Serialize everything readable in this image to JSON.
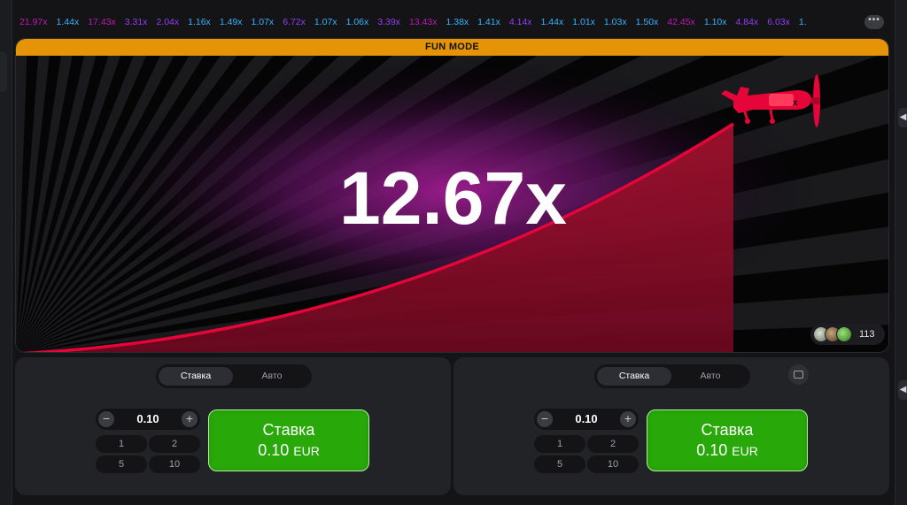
{
  "history": [
    {
      "text": "21.97x",
      "color": "pink"
    },
    {
      "text": "1.44x",
      "color": "blue"
    },
    {
      "text": "17.43x",
      "color": "pink"
    },
    {
      "text": "3.31x",
      "color": "purple"
    },
    {
      "text": "2.04x",
      "color": "purple"
    },
    {
      "text": "1.16x",
      "color": "blue"
    },
    {
      "text": "1.49x",
      "color": "blue"
    },
    {
      "text": "1.07x",
      "color": "blue"
    },
    {
      "text": "6.72x",
      "color": "purple"
    },
    {
      "text": "1.07x",
      "color": "blue"
    },
    {
      "text": "1.06x",
      "color": "blue"
    },
    {
      "text": "3.39x",
      "color": "purple"
    },
    {
      "text": "13.43x",
      "color": "pink"
    },
    {
      "text": "1.38x",
      "color": "blue"
    },
    {
      "text": "1.41x",
      "color": "blue"
    },
    {
      "text": "4.14x",
      "color": "purple"
    },
    {
      "text": "1.44x",
      "color": "blue"
    },
    {
      "text": "1.01x",
      "color": "blue"
    },
    {
      "text": "1.03x",
      "color": "blue"
    },
    {
      "text": "1.50x",
      "color": "blue"
    },
    {
      "text": "42.45x",
      "color": "pink"
    },
    {
      "text": "1.10x",
      "color": "blue"
    },
    {
      "text": "4.84x",
      "color": "purple"
    },
    {
      "text": "6.03x",
      "color": "purple"
    },
    {
      "text": "1.",
      "color": "blue"
    }
  ],
  "history_more_label": "•••",
  "colors": {
    "purple": "#913ef8",
    "blue": "#34b4ff",
    "pink": "#c017b4",
    "banner": "#e59407",
    "curve": "#e50539",
    "plane": "#e50539",
    "bet_green": "#28a909"
  },
  "game": {
    "banner_label": "FUN MODE",
    "multiplier": "12.67x",
    "players_count": "113",
    "plane_icon": "plane-icon"
  },
  "panels": [
    {
      "tab_active": "Ставка",
      "tab_inactive": "Авто",
      "amount": "0.10",
      "minus": "−",
      "plus": "+",
      "quick": [
        "1",
        "2",
        "5",
        "10"
      ],
      "bet_label": "Ставка",
      "bet_amount": "0.10",
      "currency": "EUR"
    },
    {
      "tab_active": "Ставка",
      "tab_inactive": "Авто",
      "amount": "0.10",
      "minus": "−",
      "plus": "+",
      "quick": [
        "1",
        "2",
        "5",
        "10"
      ],
      "bet_label": "Ставка",
      "bet_amount": "0.10",
      "currency": "EUR"
    }
  ]
}
